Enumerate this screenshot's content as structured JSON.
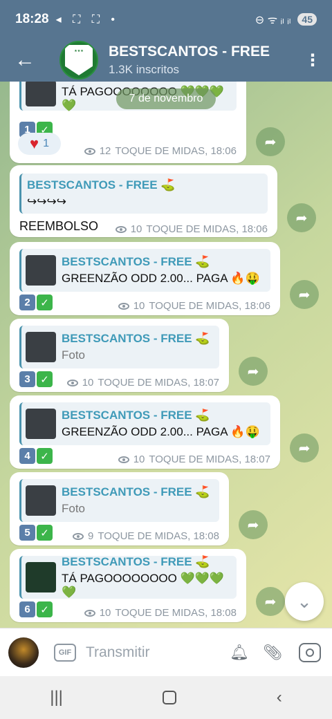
{
  "status": {
    "time": "18:28",
    "left_icons": "◂ ⛶ ⛶ •",
    "right_icons": "⊖ ᯤ ᵢₗ ᵢₗ",
    "battery": "45"
  },
  "header": {
    "title": "BESTSCANTOS - FREE",
    "subtitle": "1.3K inscritos",
    "avatar_text": "BESTSCANTOS FREE"
  },
  "date_pill": "7 de novembro",
  "messages": [
    {
      "quote_name": "",
      "quote_body": "",
      "text": "TÁ PAGOOOOOOOO 💚💚💚💚",
      "number": "1",
      "views": "12",
      "meta": "TOQUE DE MIDAS, 18:06",
      "reaction_count": "1"
    },
    {
      "quote_name": "BESTSCANTOS - FREE ⛳",
      "quote_body": "↪↪↪↪",
      "text": "REEMBOLSO",
      "views": "10",
      "meta": "TOQUE DE MIDAS, 18:06"
    },
    {
      "quote_name": "BESTSCANTOS - FREE ⛳",
      "quote_body": "GREENZÃO ODD 2.00... PAGA 🔥🤑",
      "number": "2",
      "views": "10",
      "meta": "TOQUE DE MIDAS, 18:06"
    },
    {
      "quote_name": "BESTSCANTOS - FREE ⛳",
      "quote_body": "Foto",
      "number": "3",
      "views": "10",
      "meta": "TOQUE DE MIDAS, 18:07"
    },
    {
      "quote_name": "BESTSCANTOS - FREE ⛳",
      "quote_body": "GREENZÃO ODD 2.00... PAGA 🔥🤑",
      "number": "4",
      "views": "10",
      "meta": "TOQUE DE MIDAS, 18:07"
    },
    {
      "quote_name": "BESTSCANTOS - FREE ⛳",
      "quote_body": "Foto",
      "number": "5",
      "views": "9",
      "meta": "TOQUE DE MIDAS, 18:08"
    },
    {
      "quote_name": "BESTSCANTOS - FREE ⛳",
      "quote_body": "TÁ PAGOOOOOOOO 💚💚💚💚",
      "number": "6",
      "views": "10",
      "meta": "TOQUE DE MIDAS, 18:08"
    }
  ],
  "icons": {
    "check": "✓",
    "share": "share-arrow",
    "heart": "♥"
  },
  "input": {
    "placeholder": "Transmitir",
    "gif_label": "GIF"
  },
  "colors": {
    "header_bg": "#577590",
    "accent": "#3f9ab8",
    "check_green": "#3cb54a"
  }
}
